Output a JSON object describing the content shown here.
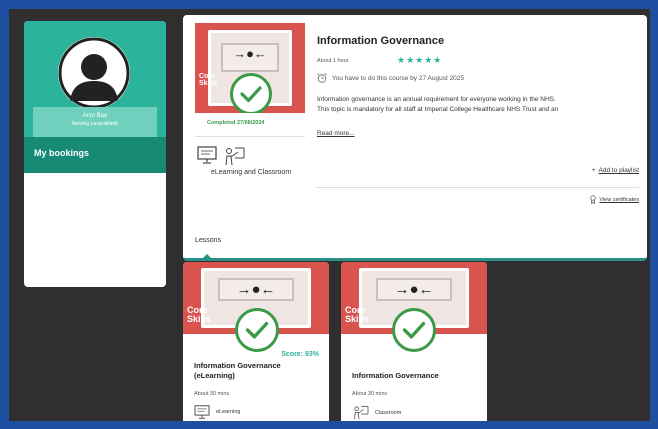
{
  "profile": {
    "name": "Arsn Bae",
    "role": "Nursing (unqualified)",
    "nav": [
      {
        "label": "My bookings"
      }
    ]
  },
  "course": {
    "thumb_tag": [
      "Core",
      "Skills"
    ],
    "completed_label": "Completed 27/08/2024",
    "mode_label": "eLearning and Classroom",
    "title": "Information Governance",
    "duration": "About 1 hour",
    "stars": "★★★★★",
    "due_text": "You have to do this course by 27 August 2025",
    "description_line1": "Information governance is an annual requirement for everyone working in the NHS.",
    "description_line2": "This topic is mandatory for all staff at Imperial College Healthcare NHS Trust and an",
    "read_more": "Read more...",
    "add_playlist_icon": "+",
    "add_playlist": "Add to playlist",
    "view_certificates": "View certificates",
    "tab_lessons": "Lessons"
  },
  "lessons": [
    {
      "thumb_tag": [
        "Core",
        "Skills"
      ],
      "score": "Score: 93%",
      "title_line1": "Information Governance",
      "title_line2": "(eLearning)",
      "duration": "About 30 mins",
      "mode": "eLearning"
    },
    {
      "thumb_tag": [
        "Core",
        "Skills"
      ],
      "title_line1": "Information Governance",
      "duration": "About 30 mins",
      "mode": "Classroom"
    }
  ],
  "colors": {
    "brand_teal": "#2bb39b",
    "nav_active": "#178a76",
    "check_green": "#3b9a45",
    "thumb_red": "#d9534f",
    "backdrop": "#2f2f2f",
    "frame_blue": "#1f4fa0"
  },
  "icons": {
    "avatar": "person-silhouette-icon",
    "completed": "check-circle-icon",
    "due": "alarm-clock-icon",
    "elearning": "monitor-icon",
    "classroom": "presenter-icon",
    "certificate": "certificate-icon"
  }
}
